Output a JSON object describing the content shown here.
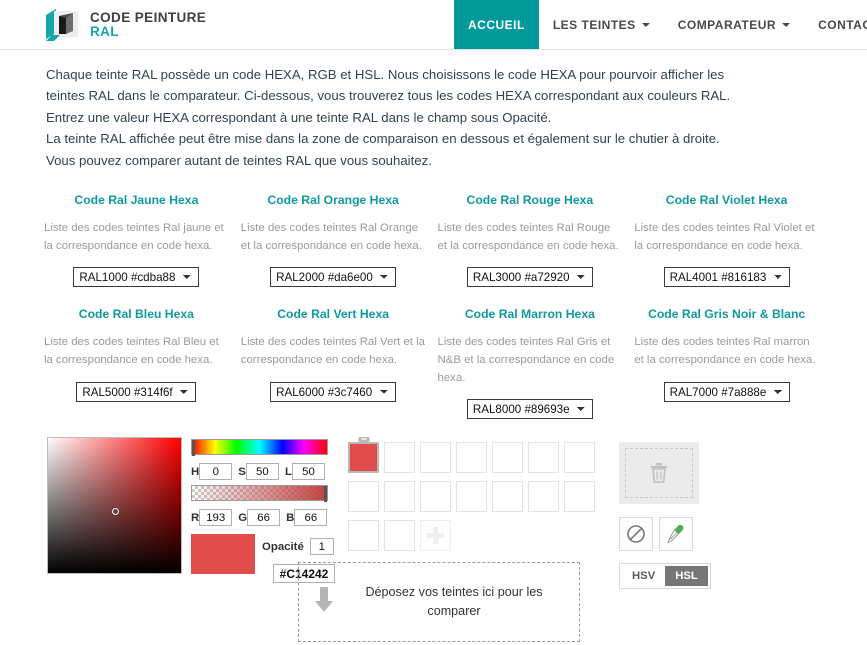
{
  "header": {
    "logo": {
      "icon": "paint-cube-logo-icon",
      "line1": "CODE PEINTURE",
      "line2": "RAL"
    },
    "nav": [
      {
        "label": "ACCUEIL",
        "active": true,
        "has_caret": false
      },
      {
        "label": "LES TEINTES",
        "active": false,
        "has_caret": true
      },
      {
        "label": "COMPARATEUR",
        "active": false,
        "has_caret": true
      },
      {
        "label": "CONTACT",
        "active": false,
        "has_caret": true
      }
    ],
    "active_color": "#009a9a"
  },
  "intro": {
    "paragraph1": "Chaque teinte RAL possède un code HEXA, RGB et HSL. Nous choisissons le code HEXA pour pourvoir afficher les teintes RAL dans le comparateur. Ci-dessous, vous trouverez tous les codes HEXA correspondant aux couleurs RAL. Entrez une valeur HEXA correspondant à une teinte RAL dans le champ sous Opacité.",
    "paragraph2": "La teinte RAL affichée peut être mise dans la zone de comparaison en dessous et également sur le chutier à droite.",
    "paragraph3": "Vous pouvez comparer autant de teintes RAL que vous souhaitez."
  },
  "categories": [
    {
      "title": "Code Ral Jaune Hexa",
      "description": "Liste des codes teintes Ral jaune et la correspondance en code hexa.",
      "selected": "RAL1000 #cdba88"
    },
    {
      "title": "Code Ral Orange Hexa",
      "description": "Liste des codes teintes Ral Orange et la correspondance en code hexa.",
      "selected": "RAL2000 #da6e00"
    },
    {
      "title": "Code Ral Rouge Hexa",
      "description": "Liste des codes teintes Ral Rouge et la correspondance en code hexa.",
      "selected": "RAL3000 #a72920"
    },
    {
      "title": "Code Ral Violet Hexa",
      "description": "Liste des codes teintes Ral Violet et la correspondance en code hexa.",
      "selected": "RAL4001 #816183"
    },
    {
      "title": "Code Ral Bleu Hexa",
      "description": "Liste des codes teintes Ral Bleu et la correspondance en code hexa.",
      "selected": "RAL5000 #314f6f"
    },
    {
      "title": "Code Ral Vert Hexa",
      "description": "Liste des codes teintes Ral Vert et la correspondance en code hexa.",
      "selected": "RAL6000 #3c7460"
    },
    {
      "title": "Code Ral Marron Hexa",
      "description": "Liste des codes teintes Ral Gris et N&B et la correspondance en code hexa.",
      "selected": "RAL8000 #89693e"
    },
    {
      "title": "Code Ral Gris Noir & Blanc",
      "description": "Liste des codes teintes Ral marron et la correspondance en code hexa.",
      "selected": "RAL7000 #7a888e"
    }
  ],
  "picker": {
    "hsl": {
      "h_label": "H",
      "h": "0",
      "s_label": "S",
      "s": "50",
      "l_label": "L",
      "l": "50"
    },
    "rgb": {
      "r_label": "R",
      "r": "193",
      "g_label": "G",
      "g": "66",
      "b_label": "B",
      "b": "66"
    },
    "opacity_label": "Opacité",
    "opacity": "1",
    "hex": "#C14242",
    "preview_color": "#e04b4b",
    "hue_color": "#ff0000"
  },
  "swatches": {
    "items": [
      {
        "filled": true,
        "color": "#e04b4b",
        "selected": true
      },
      {
        "filled": false
      },
      {
        "filled": false
      },
      {
        "filled": false
      },
      {
        "filled": false
      },
      {
        "filled": false
      },
      {
        "filled": false
      },
      {
        "filled": false
      },
      {
        "filled": false
      },
      {
        "filled": false
      },
      {
        "filled": false
      },
      {
        "filled": false
      },
      {
        "filled": false
      },
      {
        "filled": false
      },
      {
        "filled": false
      },
      {
        "filled": false
      }
    ],
    "add_icon": "plus-icon"
  },
  "tools": {
    "trash_icon": "trash-icon",
    "no_color_icon": "no-color-icon",
    "eyedropper_icon": "eyedropper-icon",
    "modes": [
      {
        "label": "HSV",
        "selected": false
      },
      {
        "label": "HSL",
        "selected": true
      }
    ]
  },
  "dropzone": {
    "arrow_icon": "down-arrow-icon",
    "text": "Déposez vos teintes ici pour les comparer"
  }
}
